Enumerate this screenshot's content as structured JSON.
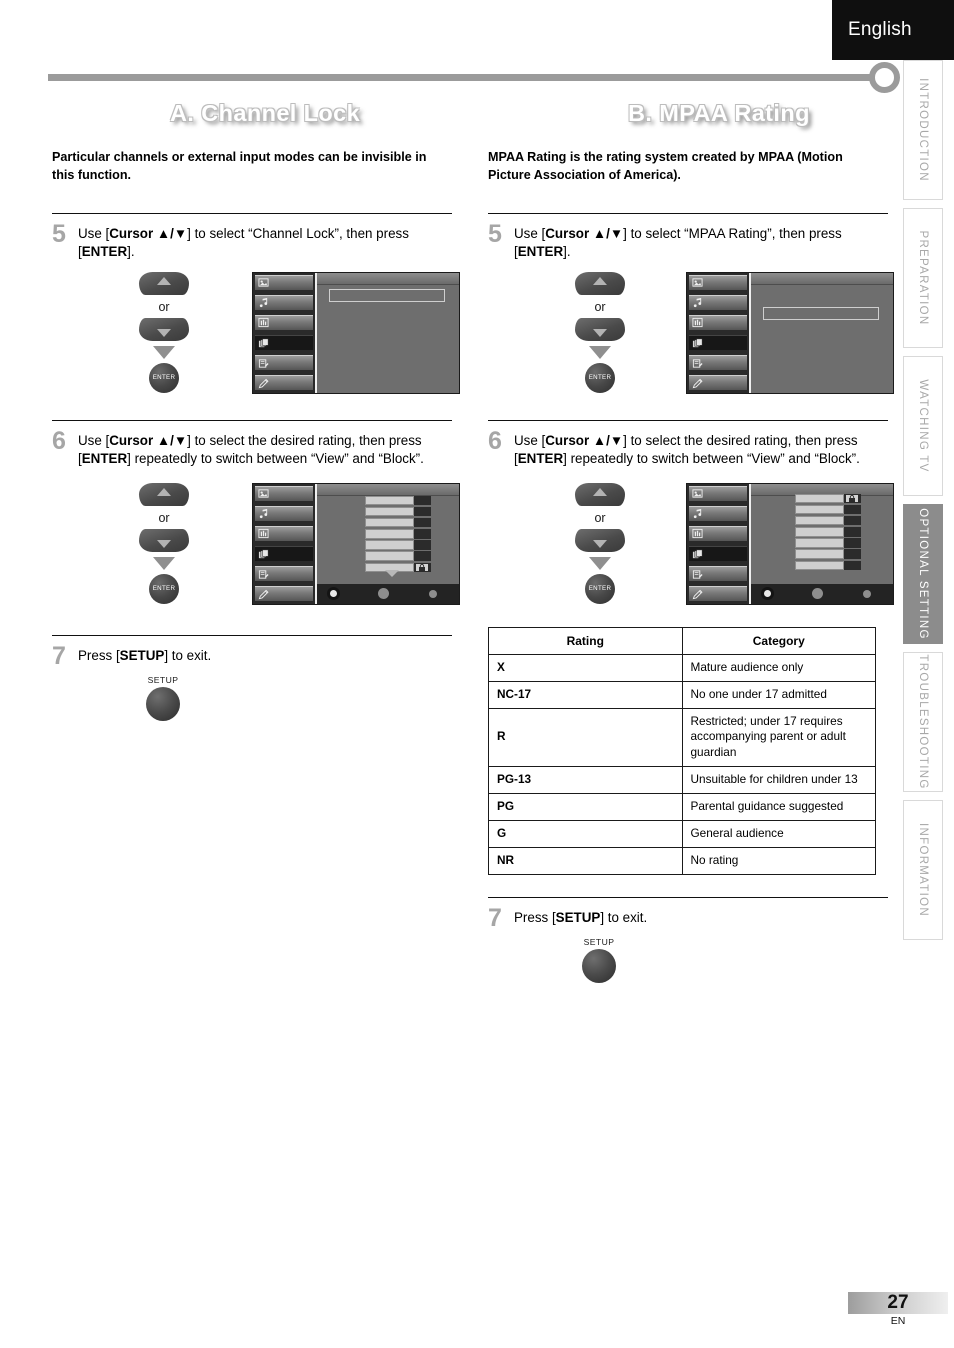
{
  "language_tab": "English",
  "side_rail": {
    "tabs": [
      {
        "label": "INTRODUCTION",
        "active": false
      },
      {
        "label": "PREPARATION",
        "active": false
      },
      {
        "label": "WATCHING  TV",
        "active": false
      },
      {
        "label": "OPTIONAL  SETTING",
        "active": true
      },
      {
        "label": "TROUBLESHOOTING",
        "active": false
      },
      {
        "label": "INFORMATION",
        "active": false
      }
    ]
  },
  "left_column": {
    "heading": "A.  Channel Lock",
    "description": "Particular channels or external input modes can be invisible in this function.",
    "steps": [
      {
        "number": "5",
        "text_html": "Use [<b>Cursor ▲/▼</b>] to select “Channel Lock”, then press [<b>ENTER</b>]."
      },
      {
        "number": "6",
        "text_html": "Use [<b>Cursor ▲/▼</b>] to select the desired rating, then press [<b>ENTER</b>] repeatedly to switch between “View” and “Block”."
      },
      {
        "number": "7",
        "text_html": "Press [<b>SETUP</b>] to exit."
      }
    ],
    "or_label": "or",
    "enter_label": "ENTER",
    "setup_label": "SETUP"
  },
  "right_column": {
    "heading": "B. MPAA Rating",
    "description": "MPAA Rating is the rating system created by MPAA (Motion Picture Association of America).",
    "steps": [
      {
        "number": "5",
        "text_html": "Use [<b>Cursor ▲/▼</b>] to select “MPAA Rating”, then press [<b>ENTER</b>]."
      },
      {
        "number": "6",
        "text_html": "Use [<b>Cursor ▲/▼</b>] to select the desired rating, then press [<b>ENTER</b>] repeatedly to switch between “View” and “Block”."
      },
      {
        "number": "7",
        "text_html": "Press [<b>SETUP</b>] to exit."
      }
    ],
    "or_label": "or",
    "enter_label": "ENTER",
    "setup_label": "SETUP"
  },
  "rating_table": {
    "headers": [
      "Rating",
      "Category"
    ],
    "rows": [
      {
        "rating": "X",
        "category": "Mature audience only"
      },
      {
        "rating": "NC-17",
        "category": "No one under 17 admitted"
      },
      {
        "rating": "R",
        "category": "Restricted; under 17 requires accompanying parent or adult guardian"
      },
      {
        "rating": "PG-13",
        "category": "Unsuitable for children under 13"
      },
      {
        "rating": "PG",
        "category": "Parental guidance suggested"
      },
      {
        "rating": "G",
        "category": "General audience"
      },
      {
        "rating": "NR",
        "category": "No rating"
      }
    ]
  },
  "footer": {
    "page_number": "27",
    "language_code": "EN"
  },
  "osd_icons": [
    "picture-icon",
    "music-note-icon",
    "equalizer-icon",
    "folders-icon",
    "document-edit-icon",
    "pencil-icon"
  ],
  "colors": {
    "rail_active_bg": "#8c8c8c",
    "rail_text": "#a8a8a8",
    "lang_tab_bg": "#0f0f0f",
    "rule_gray": "#9b9b9b",
    "step_number": "#a6a6a6"
  }
}
